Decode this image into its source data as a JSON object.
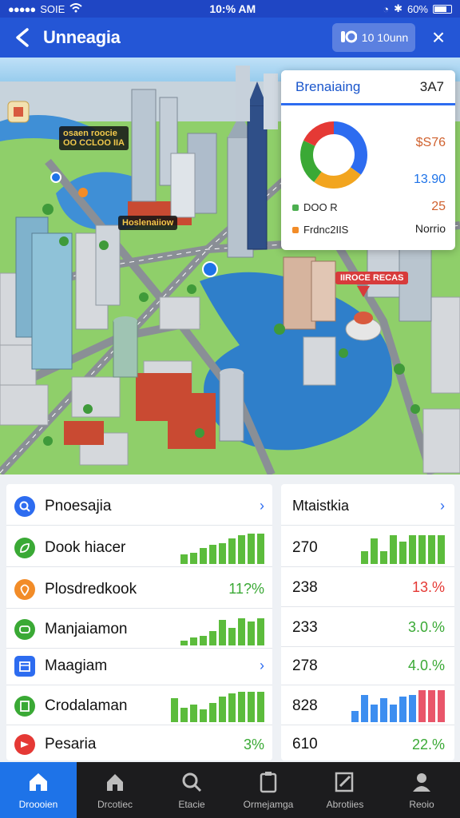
{
  "status": {
    "carrier": "SOIE",
    "time": "10:% AM",
    "battery": "60%"
  },
  "header": {
    "title": "Unneagia",
    "toggle_label": "10 10unn",
    "close": "×"
  },
  "map": {
    "labels": {
      "label_a": "osaen roocie\nOO CCLOO IIA",
      "label_b": "Hoslenaiiow",
      "label_c": "IIROCE RECAS"
    }
  },
  "stats_card": {
    "title": "Brenaiaing",
    "title_value": "3A7",
    "value_1": "$S76",
    "value_2": "13.90",
    "value_3": "25",
    "legend": [
      {
        "label": "DOO R",
        "color": "#4caf50"
      },
      {
        "label": "Frdnc2IIS",
        "color": "#f28c28"
      }
    ],
    "legend_value": "Norrio",
    "donut": {
      "segments": [
        {
          "value": 35,
          "color": "#2d6cf0"
        },
        {
          "value": 25,
          "color": "#f2a51f"
        },
        {
          "value": 22,
          "color": "#3aa935"
        },
        {
          "value": 18,
          "color": "#e53935"
        }
      ]
    }
  },
  "list": {
    "rows": [
      {
        "label": "Pnoesajia",
        "icon": "search-icon",
        "icon_color": "#2d6cf0",
        "trail": "chevron"
      },
      {
        "label": "Dook hiacer",
        "icon": "leaf-icon",
        "icon_color": "#3aa935",
        "trail": "bars",
        "bars": [
          0.3,
          0.35,
          0.5,
          0.6,
          0.65,
          0.8,
          0.9,
          0.95,
          0.95
        ]
      },
      {
        "label": "Plosdredkook",
        "icon": "pin-icon",
        "icon_color": "#f28c28",
        "trail": "pct",
        "pct": "11?%"
      },
      {
        "label": "Manjaiamon",
        "icon": "chat-icon",
        "icon_color": "#3aa935",
        "trail": "bars",
        "bars": [
          0.15,
          0.25,
          0.3,
          0.45,
          0.8,
          0.55,
          0.85,
          0.75,
          0.85
        ]
      },
      {
        "label": "Maagiam",
        "icon": "calendar-icon",
        "icon_color": "#2d6cf0",
        "trail": "chevron"
      },
      {
        "label": "Crodalaman",
        "icon": "doc-icon",
        "icon_color": "#3aa935",
        "trail": "bars",
        "bars": [
          0.75,
          0.45,
          0.55,
          0.4,
          0.6,
          0.8,
          0.9,
          0.95,
          0.95,
          0.95
        ]
      },
      {
        "label": "Pesaria",
        "icon": "flag-icon",
        "icon_color": "#e53935",
        "trail": "pct",
        "pct": "3%"
      }
    ]
  },
  "stats_list": {
    "title": "Mtaistkia",
    "rows": [
      {
        "num": "270",
        "trail": "bars",
        "bars": [
          0.4,
          0.8,
          0.4,
          0.9,
          0.7,
          0.9,
          0.9,
          0.9,
          0.9
        ]
      },
      {
        "num": "238",
        "trail": "pct",
        "pct": "13.%",
        "pct_color": "#e53935"
      },
      {
        "num": "233",
        "trail": "pct",
        "pct": "3.0.%",
        "pct_color": "#3aa935"
      },
      {
        "num": "278",
        "trail": "pct",
        "pct": "4.0.%",
        "pct_color": "#3aa935"
      },
      {
        "num": "828",
        "trail": "bars2",
        "bars": [
          0.35,
          0.85,
          0.55,
          0.75,
          0.55,
          0.8,
          0.85,
          1.0,
          1.0,
          1.0
        ]
      },
      {
        "num": "610",
        "trail": "pct",
        "pct": "22.%",
        "pct_color": "#3aa935"
      }
    ]
  },
  "tabs": [
    {
      "label": "Droooien",
      "icon": "home-icon",
      "active": true
    },
    {
      "label": "Drcotiec",
      "icon": "house-icon",
      "active": false
    },
    {
      "label": "Etacie",
      "icon": "search-icon",
      "active": false
    },
    {
      "label": "Ormejamga",
      "icon": "clipboard-icon",
      "active": false
    },
    {
      "label": "Abrotiies",
      "icon": "edit-icon",
      "active": false
    },
    {
      "label": "Reoio",
      "icon": "person-icon",
      "active": false
    }
  ]
}
